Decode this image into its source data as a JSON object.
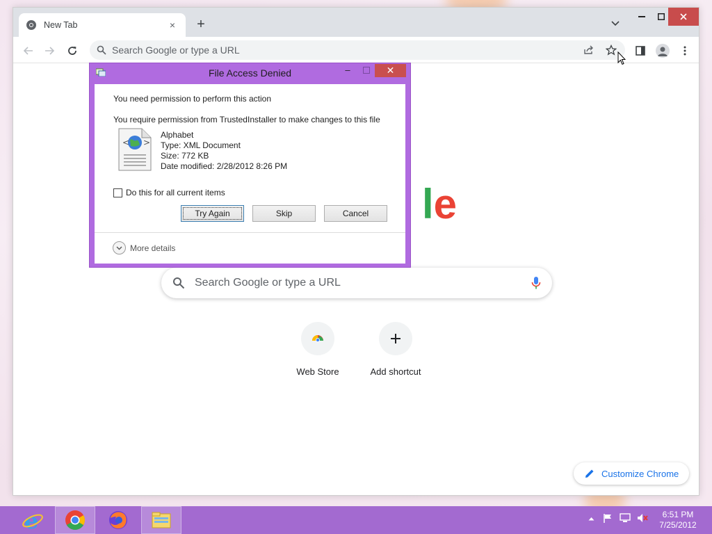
{
  "browser": {
    "tab_title": "New Tab",
    "tab_close": "×",
    "new_tab": "+",
    "omnibox_placeholder": "Search Google or type a URL",
    "colors": {
      "tabstrip": "#dee1e6",
      "omnibox": "#f1f3f4",
      "accent": "#1a73e8"
    }
  },
  "ntp": {
    "logo_fragment_l": "l",
    "logo_fragment_e": "e",
    "search_placeholder": "Search Google or type a URL",
    "shortcuts": [
      {
        "label": "Web Store",
        "icon": "chrome-web-store-icon"
      },
      {
        "label": "Add shortcut",
        "icon": "plus-icon"
      }
    ],
    "customize_label": "Customize Chrome"
  },
  "dialog": {
    "title": "File Access Denied",
    "close_glyph": "✕",
    "min_glyph": "–",
    "heading": "You need permission to perform this action",
    "message": "You require permission from TrustedInstaller to make changes to this file",
    "file": {
      "name": "Alphabet",
      "type": "Type: XML Document",
      "size": "Size: 772 KB",
      "modified": "Date modified: 2/28/2012 8:26 PM"
    },
    "checkbox_label": "Do this for all current items",
    "checkbox_checked": false,
    "buttons": {
      "try_again": "Try Again",
      "skip": "Skip",
      "cancel": "Cancel"
    },
    "more_details": "More details",
    "colors": {
      "frame": "#b06be0",
      "close": "#c94f4f"
    }
  },
  "taskbar": {
    "apps": [
      "internet-explorer-icon",
      "chrome-icon",
      "firefox-icon",
      "file-explorer-icon"
    ],
    "clock_time": "6:51 PM",
    "clock_date": "7/25/2012",
    "colors": {
      "background": "#a36ad0"
    }
  }
}
